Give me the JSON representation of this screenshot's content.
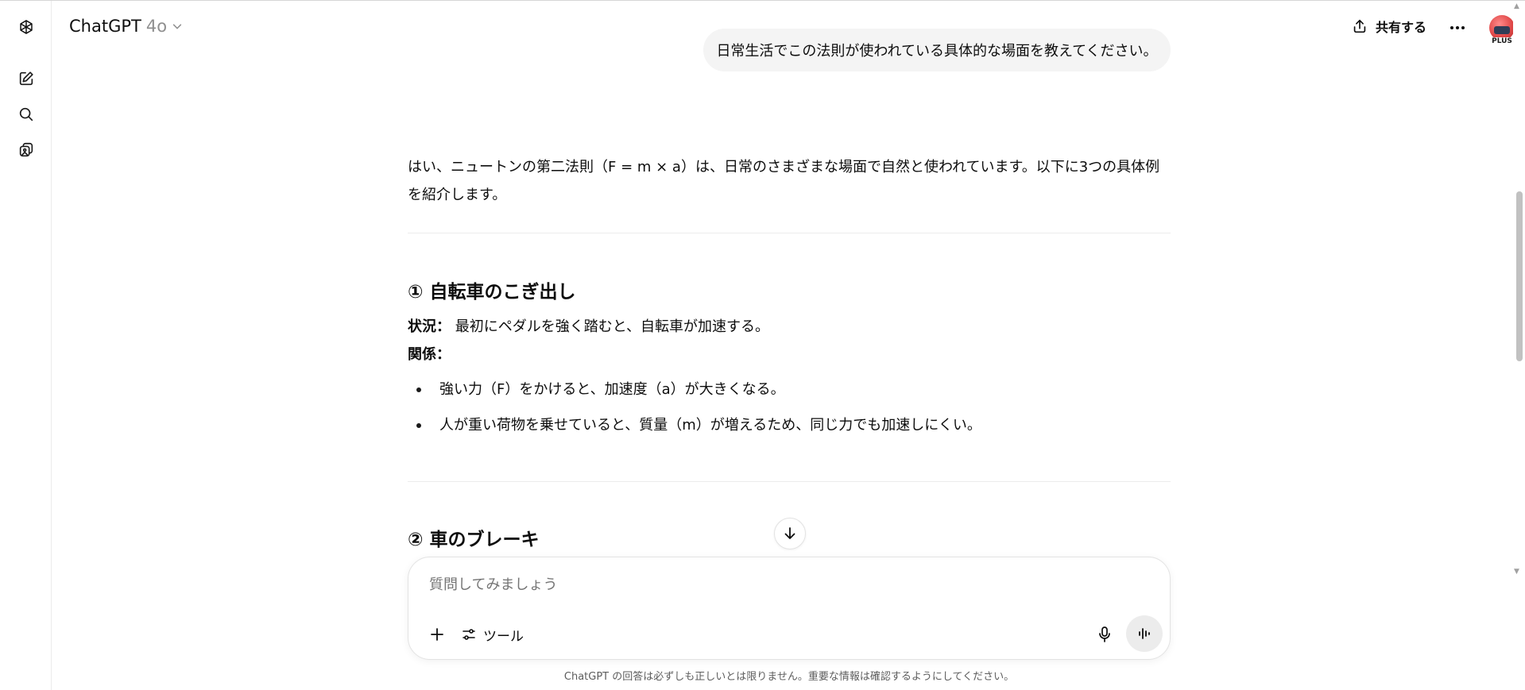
{
  "header": {
    "model_name": "ChatGPT",
    "model_version": "4o",
    "share_label": "共有する",
    "avatar_badge": "PLUS"
  },
  "sidebar": {
    "items": [
      {
        "icon": "openai-logo-icon"
      },
      {
        "icon": "new-chat-icon"
      },
      {
        "icon": "search-icon"
      },
      {
        "icon": "library-icon"
      }
    ]
  },
  "conversation": {
    "user_message": "日常生活でこの法則が使われている具体的な場面を教えてください。",
    "assistant": {
      "intro": "はい、ニュートンの第二法則（F = m × a）は、日常のさまざまな場面で自然と使われています。以下に3つの具体例を紹介します。",
      "section1": {
        "heading": "① 自転車のこぎ出し",
        "situation_label": "状況：",
        "situation_text": "最初にペダルを強く踏むと、自転車が加速する。",
        "relation_label": "関係：",
        "bullets": [
          "強い力（F）をかけると、加速度（a）が大きくなる。",
          "人が重い荷物を乗せていると、質量（m）が増えるため、同じ力でも加速しにくい。"
        ]
      },
      "section2": {
        "heading": "② 車のブレーキ"
      }
    }
  },
  "composer": {
    "placeholder": "質問してみましょう",
    "tools_label": "ツール"
  },
  "footer": {
    "disclaimer": "ChatGPT の回答は必ずしも正しいとは限りません。重要な情報は確認するようにしてください。"
  }
}
